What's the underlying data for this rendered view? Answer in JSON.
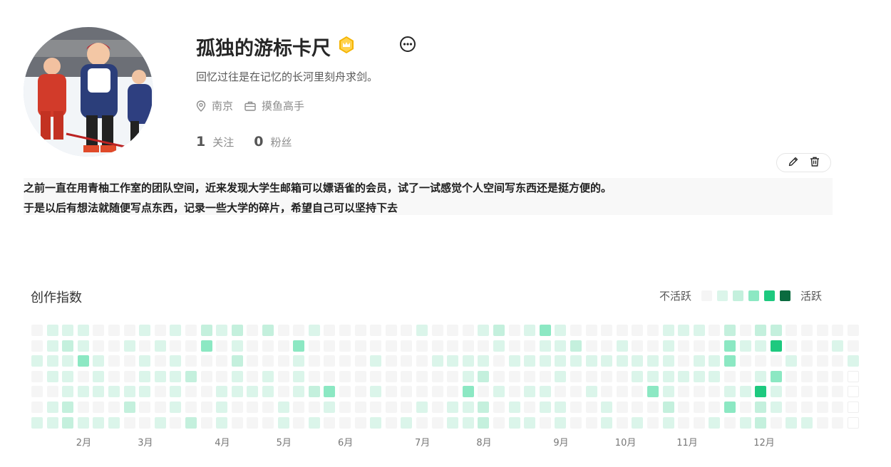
{
  "profile": {
    "name": "孤独的游标卡尺",
    "bio": "回忆过往是在记忆的长河里刻舟求剑。",
    "location": "南京",
    "job": "摸鱼高手",
    "following_count": "1",
    "following_label": "关注",
    "followers_count": "0",
    "followers_label": "粉丝",
    "badge_icon": "crown-icon",
    "more_icon": "more-icon"
  },
  "post": {
    "line1": "之前一直在用青柚工作室的团队空间，近来发现大学生邮箱可以嫖语雀的会员，试了一试感觉个人空间写东西还是挺方便的。",
    "line2": "于是以后有想法就随便写点东西，记录一些大学的碎片，希望自己可以坚持下去"
  },
  "heatmap": {
    "title": "创作指数",
    "legend_low": "不活跃",
    "legend_high": "活跃",
    "colors": [
      "#f5f5f5",
      "#dbf5ea",
      "#c4f0dd",
      "#8ce8c3",
      "#1ec97f",
      "#0a6b3f"
    ],
    "months": [
      "2月",
      "3月",
      "4月",
      "5月",
      "6月",
      "7月",
      "8月",
      "9月",
      "10月",
      "11月",
      "12月"
    ],
    "month_columns": [
      3,
      7,
      12,
      16,
      20,
      25,
      29,
      34,
      38,
      42,
      47
    ],
    "levels": [
      [
        0,
        1,
        1,
        1,
        0,
        0,
        0,
        1,
        0,
        1,
        0,
        2,
        1,
        2,
        0,
        2,
        0,
        0,
        1,
        0,
        0,
        0,
        0,
        0,
        0,
        1,
        0,
        0,
        0,
        1,
        2,
        0,
        1,
        3,
        1,
        0,
        0,
        0,
        0,
        0,
        0,
        1,
        1,
        1,
        0,
        2,
        0,
        2,
        2,
        0,
        0,
        0,
        0,
        0
      ],
      [
        0,
        1,
        2,
        1,
        0,
        0,
        1,
        0,
        1,
        0,
        0,
        3,
        0,
        1,
        0,
        0,
        0,
        3,
        0,
        0,
        0,
        0,
        0,
        0,
        0,
        0,
        0,
        0,
        0,
        0,
        1,
        0,
        0,
        1,
        1,
        2,
        0,
        0,
        1,
        0,
        0,
        1,
        0,
        0,
        0,
        3,
        1,
        1,
        4,
        0,
        0,
        0,
        1,
        0
      ],
      [
        1,
        1,
        1,
        3,
        1,
        0,
        0,
        1,
        0,
        1,
        0,
        0,
        0,
        2,
        0,
        0,
        0,
        1,
        0,
        0,
        0,
        0,
        1,
        0,
        0,
        0,
        1,
        1,
        1,
        1,
        0,
        1,
        1,
        1,
        1,
        1,
        1,
        1,
        1,
        1,
        1,
        1,
        0,
        1,
        1,
        3,
        0,
        0,
        0,
        1,
        0,
        0,
        0,
        1
      ],
      [
        0,
        1,
        1,
        0,
        1,
        0,
        0,
        1,
        1,
        1,
        2,
        0,
        0,
        1,
        0,
        1,
        0,
        1,
        0,
        0,
        0,
        0,
        0,
        0,
        0,
        0,
        0,
        0,
        1,
        2,
        0,
        0,
        0,
        0,
        1,
        0,
        0,
        0,
        0,
        1,
        1,
        1,
        1,
        1,
        1,
        0,
        0,
        1,
        3,
        0,
        0,
        0,
        0,
        0
      ],
      [
        0,
        0,
        1,
        1,
        1,
        1,
        1,
        1,
        0,
        1,
        0,
        0,
        1,
        1,
        1,
        1,
        0,
        1,
        2,
        3,
        0,
        0,
        1,
        0,
        0,
        0,
        0,
        0,
        3,
        0,
        1,
        0,
        1,
        1,
        0,
        0,
        1,
        0,
        0,
        0,
        3,
        1,
        0,
        0,
        0,
        1,
        1,
        4,
        1,
        0,
        0,
        0,
        0,
        0
      ],
      [
        0,
        1,
        2,
        0,
        0,
        0,
        2,
        0,
        0,
        1,
        0,
        0,
        1,
        0,
        0,
        0,
        1,
        0,
        0,
        1,
        0,
        0,
        0,
        0,
        0,
        1,
        0,
        1,
        1,
        2,
        0,
        1,
        0,
        1,
        1,
        0,
        0,
        1,
        0,
        0,
        0,
        2,
        0,
        0,
        0,
        3,
        0,
        2,
        1,
        0,
        0,
        0,
        0,
        2
      ],
      [
        1,
        1,
        2,
        1,
        1,
        1,
        0,
        0,
        1,
        0,
        2,
        0,
        1,
        0,
        0,
        0,
        1,
        0,
        1,
        0,
        0,
        0,
        1,
        0,
        1,
        0,
        0,
        1,
        1,
        2,
        0,
        1,
        1,
        0,
        1,
        0,
        0,
        1,
        0,
        1,
        0,
        1,
        0,
        0,
        1,
        0,
        1,
        2,
        0,
        1,
        1,
        0,
        0,
        1
      ]
    ]
  }
}
